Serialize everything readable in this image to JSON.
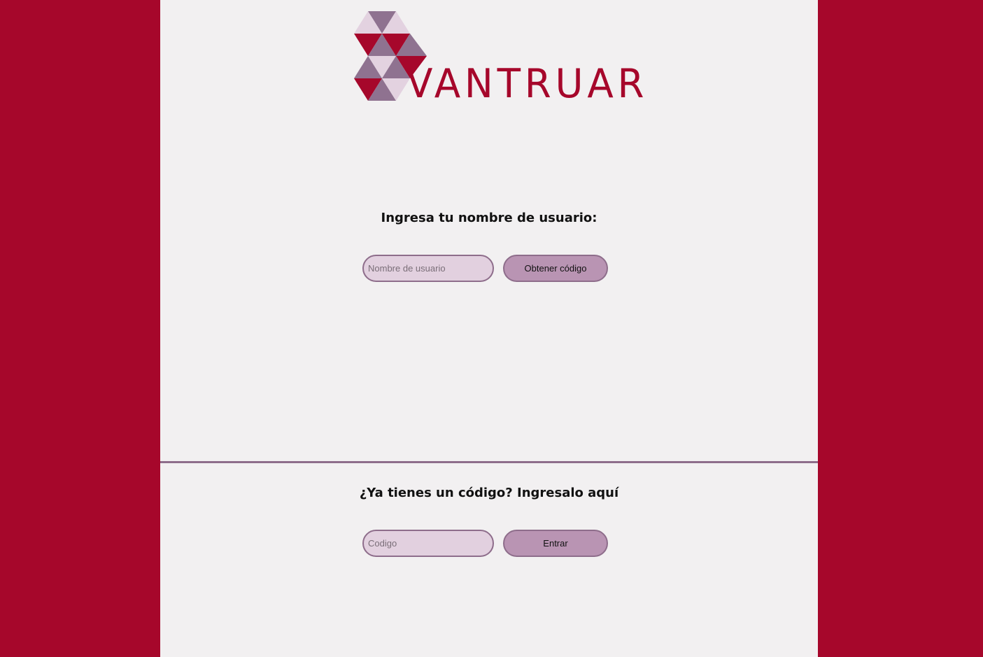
{
  "brand": {
    "name": "VANTRUAR"
  },
  "colors": {
    "background": "#a6072b",
    "panel": "#f2f0f1",
    "accent": "#8e6d8b",
    "input_fill": "#e2d0df",
    "button_fill": "#b994b3"
  },
  "request_section": {
    "heading": "Ingresa tu nombre de usuario:",
    "username_placeholder": "Nombre de usuario",
    "button_label": "Obtener código"
  },
  "code_section": {
    "heading": "¿Ya tienes un código? Ingresalo aquí",
    "code_placeholder": "Codigo",
    "button_label": "Entrar"
  }
}
